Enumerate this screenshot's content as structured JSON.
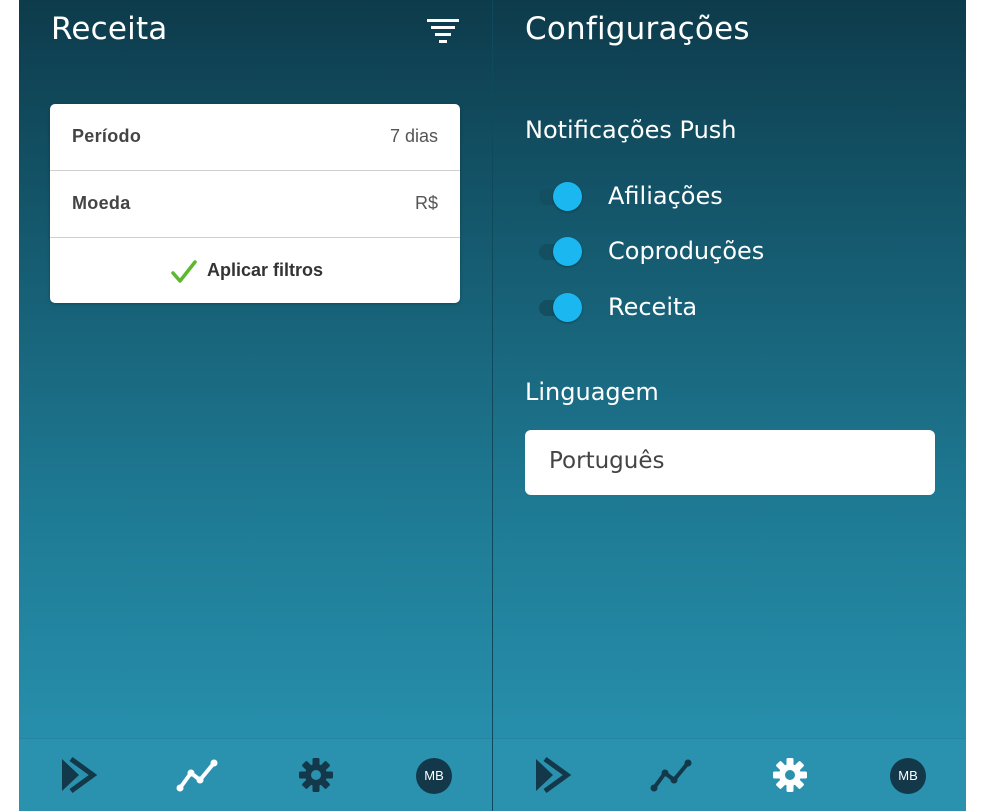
{
  "left_screen": {
    "title": "Receita",
    "filter_icon": "filter-lines-icon",
    "filters": {
      "period_label": "Período",
      "period_value": "7 dias",
      "currency_label": "Moeda",
      "currency_value": "R$",
      "apply_label": "Aplicar filtros",
      "apply_icon": "check-icon",
      "check_color": "#5cb82f"
    }
  },
  "right_screen": {
    "title": "Configurações",
    "push_heading": "Notificações Push",
    "toggles": [
      {
        "label": "Afiliações",
        "on": true
      },
      {
        "label": "Coproduções",
        "on": true
      },
      {
        "label": "Receita",
        "on": true
      }
    ],
    "language_heading": "Linguagem",
    "language_value": "Português",
    "toggle_color": "#1ab7f0"
  },
  "bottom_nav": {
    "items": [
      "play-icon",
      "chart-icon",
      "gear-icon",
      "avatar"
    ],
    "avatar_initials": "MB",
    "active_color": "#ffffff",
    "inactive_color": "#12384a"
  }
}
